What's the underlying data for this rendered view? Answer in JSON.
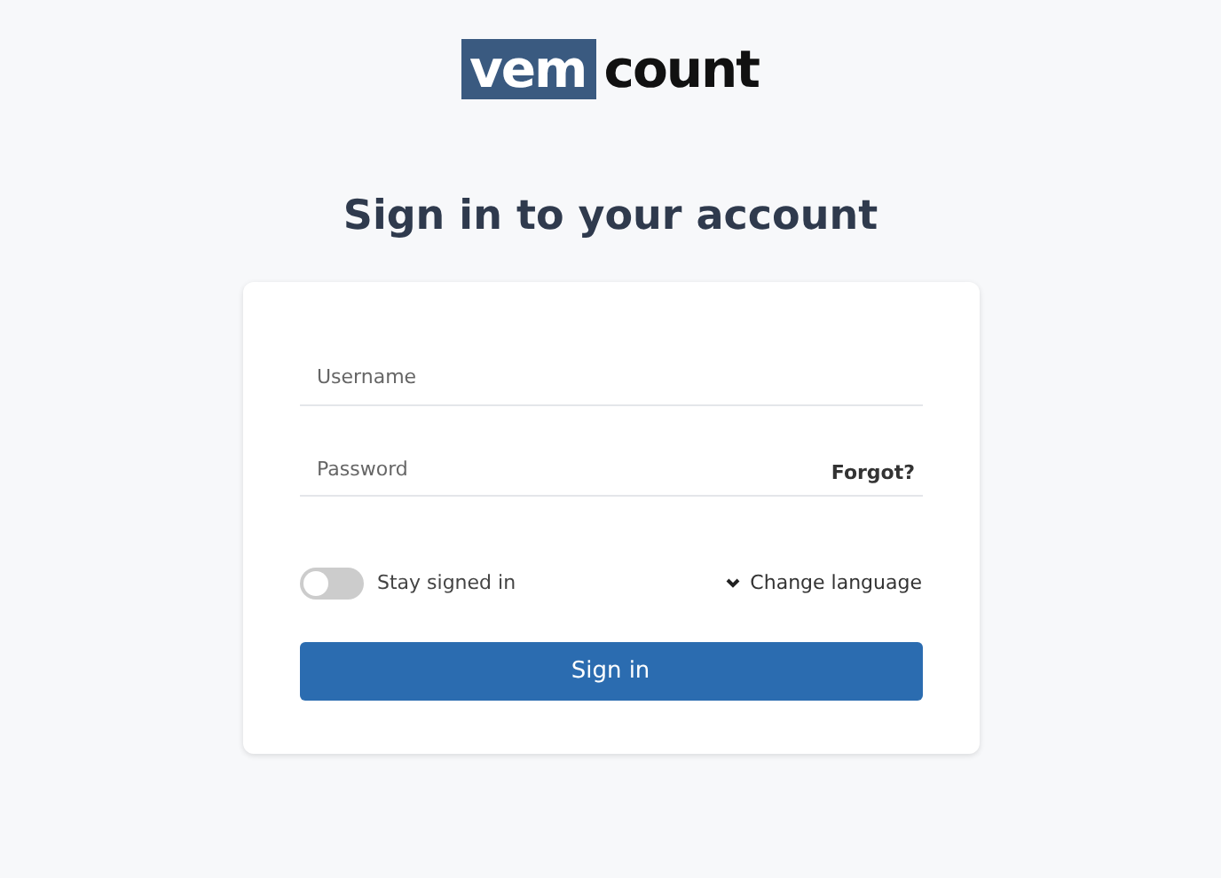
{
  "logo": {
    "part_1": "vem",
    "part_2": "count"
  },
  "heading": "Sign in to your account",
  "username": {
    "placeholder": "Username"
  },
  "password": {
    "placeholder": "Password",
    "link": "Forgot?"
  },
  "stay_signed_in": {
    "label": "Stay signed in",
    "on": false
  },
  "language": {
    "label": "Change language"
  },
  "submit": "Sign in"
}
